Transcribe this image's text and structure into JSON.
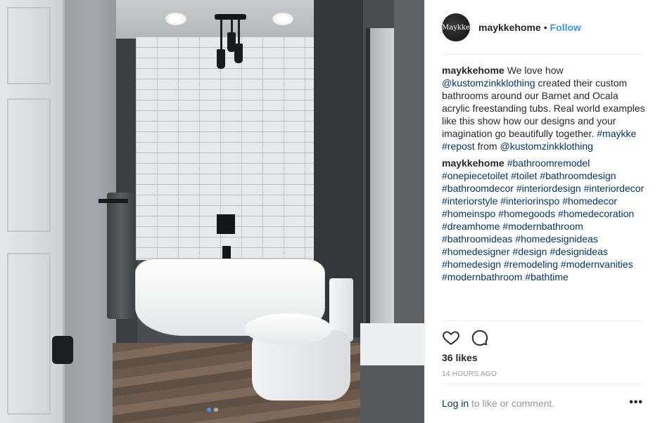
{
  "header": {
    "avatar_text": "Maykke",
    "username": "maykkehome",
    "separator": "•",
    "follow_label": "Follow"
  },
  "caption": {
    "username": "maykkehome",
    "parts": [
      {
        "text": "We love how ",
        "link": false
      },
      {
        "text": "@kustomzinkklothing",
        "link": true
      },
      {
        "text": " created their custom bathrooms around our Barnet and Ocala acrylic freestanding tubs. Real world examples like this show how our designs and your imagination go beautifully together. ",
        "link": false
      },
      {
        "text": "#maykke",
        "link": true
      },
      {
        "text": " ",
        "link": false
      },
      {
        "text": "#repost",
        "link": true
      },
      {
        "text": " from ",
        "link": false
      },
      {
        "text": "@kustomzinkklothing",
        "link": true
      }
    ]
  },
  "hashtag_comment": {
    "username": "maykkehome",
    "tags": [
      "#bathroomremodel",
      "#onepiecetoilet",
      "#toilet",
      "#bathroomdesign",
      "#bathroomdecor",
      "#interiordesign",
      "#interiordecor",
      "#interiorstyle",
      "#interiorinspo",
      "#homedecor",
      "#homeinspo",
      "#homegoods",
      "#homedecoration",
      "#dreamhome",
      "#modernbathroom",
      "#bathroomideas",
      "#homedesignideas",
      "#homedesigner",
      "#design",
      "#designideas",
      "#homedesign",
      "#remodeling",
      "#modernvanities",
      "#modernbathroom",
      "#bathtime"
    ]
  },
  "actions": {
    "like_icon": "heart-icon",
    "comment_icon": "comment-icon",
    "likes": "36 likes",
    "timestamp": "14 HOURS AGO",
    "login_link": "Log in",
    "login_suffix": " to like or comment.",
    "more_icon": "more-options-icon",
    "more_label": "•••"
  },
  "carousel": {
    "slides": 2,
    "current": 1
  },
  "colors": {
    "link": "#003569",
    "follow": "#3897f0",
    "muted": "#999999",
    "text": "#262626"
  }
}
